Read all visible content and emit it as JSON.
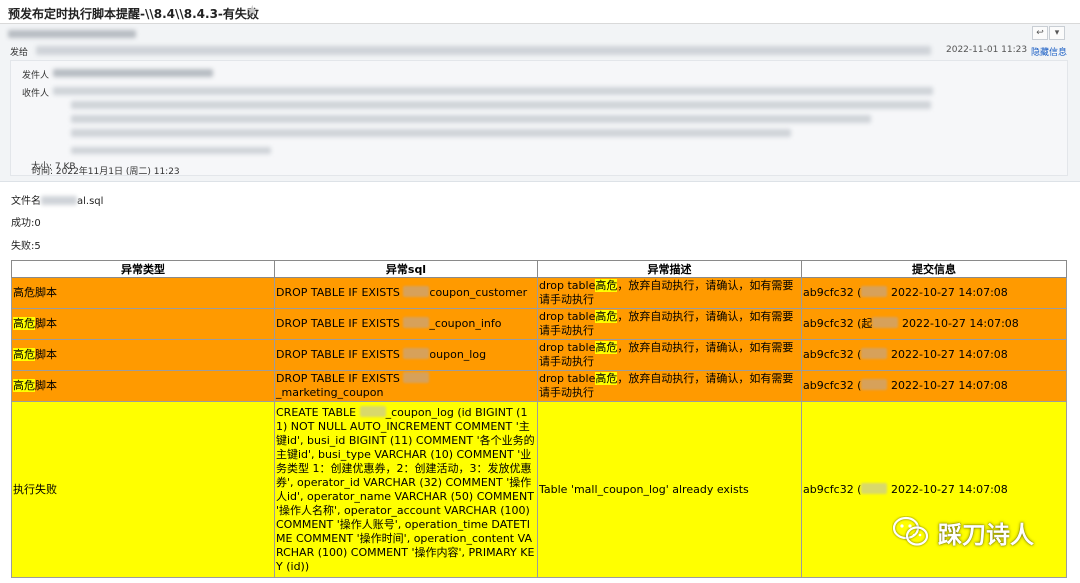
{
  "window": {
    "title": "预发布定时执行脚本提醒-\\\\8.4\\\\8.4.3-有失败"
  },
  "header": {
    "sender_label": "发给",
    "send_time": "2022-11-01 11:23",
    "hide_link": "隐藏信息",
    "from_label": "发件人",
    "to_label": "收件人",
    "time_label": "时间: 2022年11月1日 (周二) 11:23",
    "size_label": "大小: 7 KB"
  },
  "body": {
    "file_prefix": "文件名",
    "file_suffix": "al.sql",
    "success": "成功:0",
    "fail": "失败:5"
  },
  "table": {
    "headers": [
      "异常类型",
      "异常sql",
      "异常描述",
      "提交信息"
    ],
    "rows": [
      {
        "type_a": "高危",
        "type_b": "脚本",
        "sql_a": "DROP TABLE IF EXISTS ",
        "sql_b": "coupon_customer",
        "desc_a": "drop table",
        "desc_b": "高危",
        "desc_c": "，放弃自动执行，请确认，如有需要请手动执行",
        "commit_a": "ab9cfc32 (",
        "commit_b": " 2022-10-27 14:07:08"
      },
      {
        "type_a": "高危",
        "type_b": "脚本",
        "sql_a": "DROP TABLE IF EXISTS ",
        "sql_b": "_coupon_info",
        "desc_a": "drop table",
        "desc_b": "高危",
        "desc_c": "，放弃自动执行，请确认，如有需要请手动执行",
        "commit_a": "ab9cfc32 (起",
        "commit_b": " 2022-10-27 14:07:08"
      },
      {
        "type_a": "高危",
        "type_b": "脚本",
        "sql_a": "DROP TABLE IF EXISTS ",
        "sql_b": "oupon_log",
        "desc_a": "drop table",
        "desc_b": "高危",
        "desc_c": "，放弃自动执行，请确认，如有需要请手动执行",
        "commit_a": "ab9cfc32 (",
        "commit_b": " 2022-10-27 14:07:08"
      },
      {
        "type_a": "高危",
        "type_b": "脚本",
        "sql_a": "DROP TABLE IF EXISTS ",
        "sql_b": "_marketing_coupon",
        "desc_a": "drop table",
        "desc_b": "高危",
        "desc_c": "，放弃自动执行，请确认，如有需要请手动执行",
        "commit_a": "ab9cfc32 (",
        "commit_b": " 2022-10-27 14:07:08"
      }
    ],
    "fail_row": {
      "type": "执行失败",
      "sql_a": "CREATE TABLE ",
      "sql_b": "_coupon_log (id BIGINT (11) NOT NULL AUTO_INCREMENT COMMENT '主键id', busi_id BIGINT (11) COMMENT '各个业务的主键id', busi_type VARCHAR (10) COMMENT '业务类型 1：创建优惠券，2：创建活动，3：发放优惠券', operator_id VARCHAR (32) COMMENT '操作人id', operator_name VARCHAR (50) COMMENT '操作人名称', operator_account VARCHAR (100) COMMENT '操作人账号', operation_time DATETIME COMMENT '操作时间', operation_content VARCHAR (100) COMMENT '操作内容', PRIMARY KEY (id))",
      "desc": "Table 'mall_coupon_log' already exists",
      "commit_a": "ab9cfc32 (",
      "commit_b": " 2022-10-27 14:07:08"
    }
  },
  "watermark": {
    "text": "踩刀诗人",
    "icon": "wechat-icon"
  },
  "colors": {
    "danger_row": "#ff9a00",
    "fail_row": "#ffff00",
    "highlight": "#ffff00",
    "link": "#1a5ec4"
  }
}
